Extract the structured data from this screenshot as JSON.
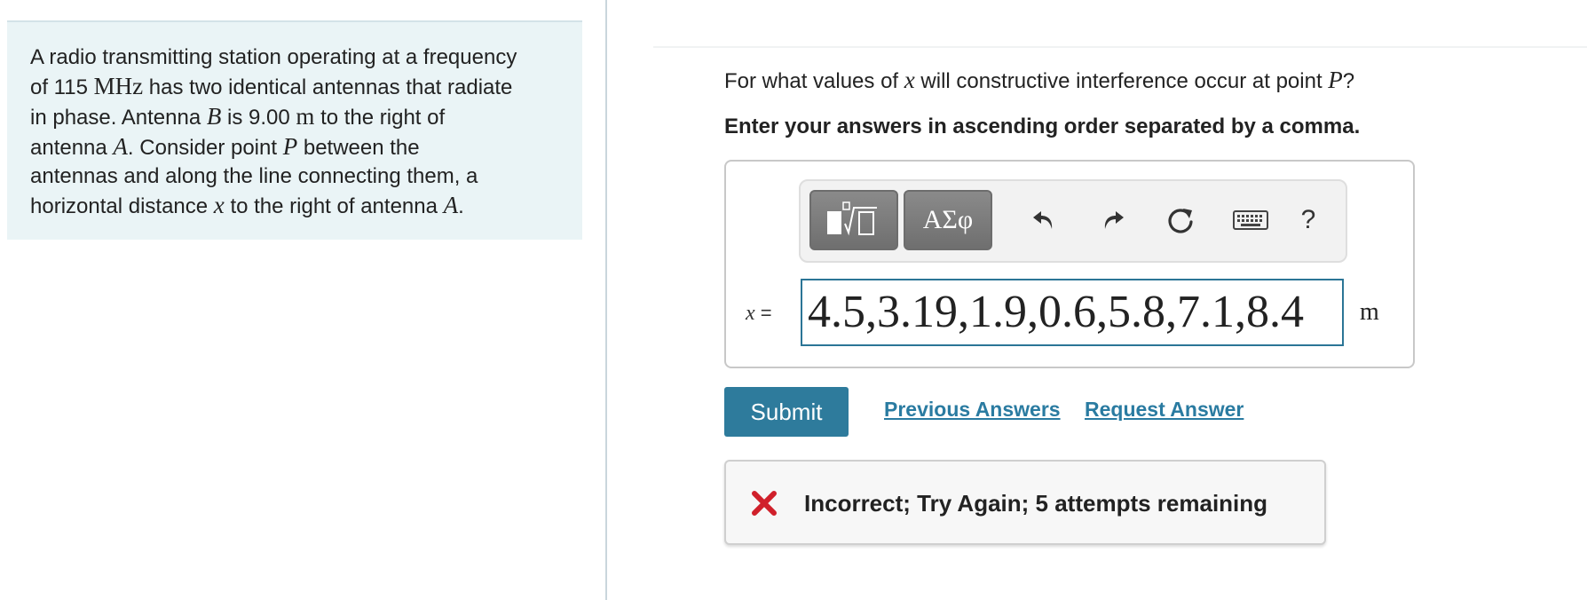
{
  "problem": {
    "t1": "A radio transmitting station operating at a frequency",
    "t2": "of 115 ",
    "unit_mhz": "MHz",
    "t3": " has two identical antennas that radiate",
    "t4": "in phase. Antenna ",
    "var_b": "B",
    "t5": " is 9.00 ",
    "unit_m": "m",
    "t6": " to the right of",
    "t7": "antenna ",
    "var_a": "A",
    "t8": ". Consider point ",
    "var_p": "P",
    "t9": " between the",
    "t10": "antennas and along the line connecting them, a",
    "t11": "horizontal distance ",
    "var_x": "x",
    "t12": " to the right of antenna ",
    "var_a2": "A",
    "t13": "."
  },
  "question": {
    "part1": "For what values of ",
    "var_x": "x",
    "part2": " will constructive interference occur at point ",
    "var_p": "P",
    "part3": "?"
  },
  "instruction": "Enter your answers in ascending order separated by a comma.",
  "toolbar": {
    "greek_label": "ΑΣφ",
    "help_label": "?",
    "icons": [
      "templates-icon",
      "undo-icon",
      "redo-icon",
      "reset-icon",
      "keyboard-icon"
    ]
  },
  "answer": {
    "var_label": "x",
    "equals": " =",
    "value": "4.5,3.19,1.9,0.6,5.8,7.1,8.4",
    "unit": "m"
  },
  "actions": {
    "submit_label": "Submit",
    "previous_answers_label": "Previous Answers",
    "request_answer_label": "Request Answer"
  },
  "feedback": {
    "message": "Incorrect; Try Again; 5 attempts remaining",
    "status_color": "#d0202b"
  },
  "colors": {
    "accent": "#2e7b9c",
    "link": "#2a7ba1",
    "panel_bg": "#eaf4f6"
  }
}
